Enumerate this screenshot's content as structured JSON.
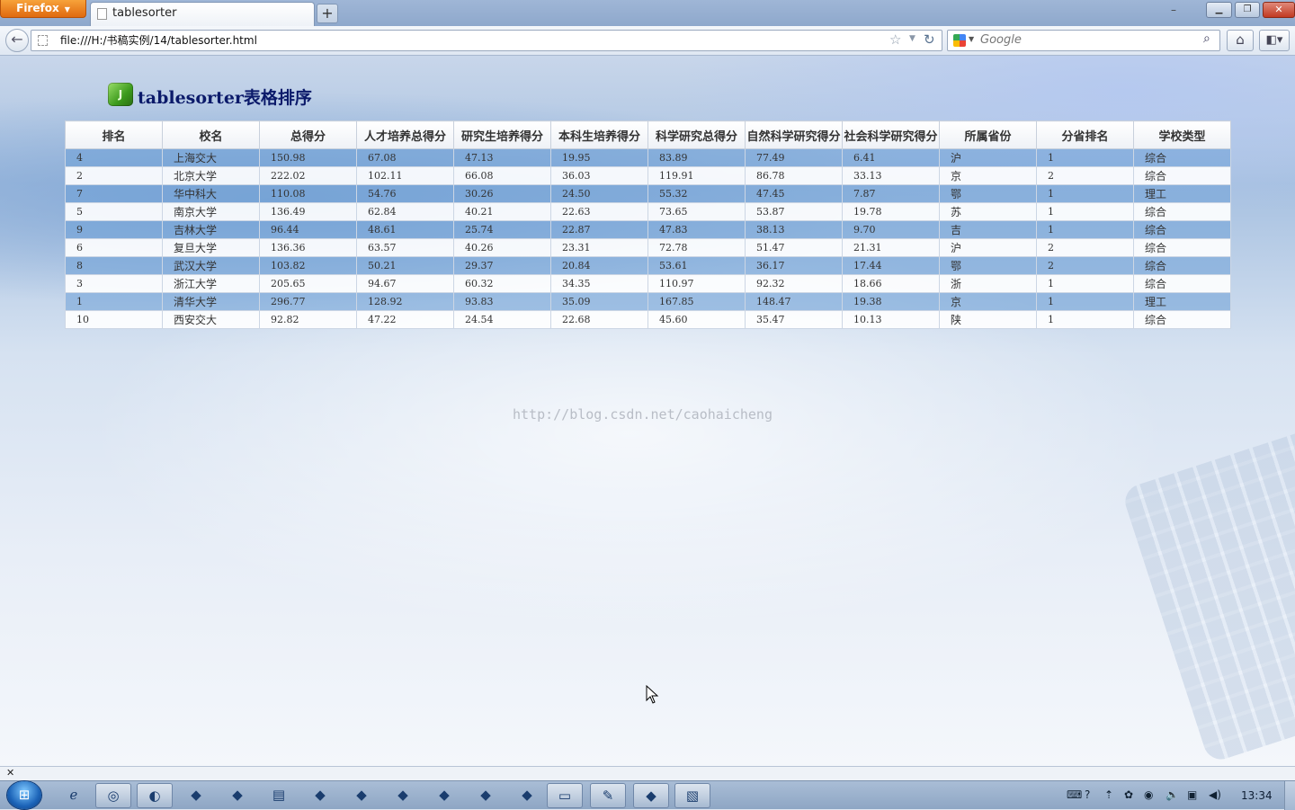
{
  "browser": {
    "app_button": "Firefox",
    "tab_title": "tablesorter",
    "new_tab_label": "+",
    "url": "file:///H:/书稿实例/14/tablesorter.html",
    "search_placeholder": "Google"
  },
  "page": {
    "logo_letter": "J",
    "title": "tablesorter表格排序",
    "watermark": "http://blog.csdn.net/caohaicheng"
  },
  "table": {
    "headers": [
      "排名",
      "校名",
      "总得分",
      "人才培养总得分",
      "研究生培养得分",
      "本科生培养得分",
      "科学研究总得分",
      "自然科学研究得分",
      "社会科学研究得分",
      "所属省份",
      "分省排名",
      "学校类型"
    ],
    "rows": [
      [
        "4",
        "上海交大",
        "150.98",
        "67.08",
        "47.13",
        "19.95",
        "83.89",
        "77.49",
        "6.41",
        "沪",
        "1",
        "综合"
      ],
      [
        "2",
        "北京大学",
        "222.02",
        "102.11",
        "66.08",
        "36.03",
        "119.91",
        "86.78",
        "33.13",
        "京",
        "2",
        "综合"
      ],
      [
        "7",
        "华中科大",
        "110.08",
        "54.76",
        "30.26",
        "24.50",
        "55.32",
        "47.45",
        "7.87",
        "鄂",
        "1",
        "理工"
      ],
      [
        "5",
        "南京大学",
        "136.49",
        "62.84",
        "40.21",
        "22.63",
        "73.65",
        "53.87",
        "19.78",
        "苏",
        "1",
        "综合"
      ],
      [
        "9",
        "吉林大学",
        "96.44",
        "48.61",
        "25.74",
        "22.87",
        "47.83",
        "38.13",
        "9.70",
        "吉",
        "1",
        "综合"
      ],
      [
        "6",
        "复旦大学",
        "136.36",
        "63.57",
        "40.26",
        "23.31",
        "72.78",
        "51.47",
        "21.31",
        "沪",
        "2",
        "综合"
      ],
      [
        "8",
        "武汉大学",
        "103.82",
        "50.21",
        "29.37",
        "20.84",
        "53.61",
        "36.17",
        "17.44",
        "鄂",
        "2",
        "综合"
      ],
      [
        "3",
        "浙江大学",
        "205.65",
        "94.67",
        "60.32",
        "34.35",
        "110.97",
        "92.32",
        "18.66",
        "浙",
        "1",
        "综合"
      ],
      [
        "1",
        "清华大学",
        "296.77",
        "128.92",
        "93.83",
        "35.09",
        "167.85",
        "148.47",
        "19.38",
        "京",
        "1",
        "理工"
      ],
      [
        "10",
        "西安交大",
        "92.82",
        "47.22",
        "24.54",
        "22.68",
        "45.60",
        "35.47",
        "10.13",
        "陕",
        "1",
        "综合"
      ]
    ]
  },
  "taskbar": {
    "clock": "13:34",
    "icons": [
      "ie-icon",
      "chrome-icon",
      "firefox-icon",
      "app-icon",
      "app-icon",
      "document-icon",
      "app-icon",
      "app-icon",
      "app-icon",
      "app-icon",
      "app-icon",
      "app-icon",
      "folder-icon",
      "notepad-icon",
      "app-icon",
      "pdf-icon"
    ]
  },
  "colors": {
    "accent_heading": "#0b1a6a",
    "row_highlight": "#6ea0d7"
  }
}
